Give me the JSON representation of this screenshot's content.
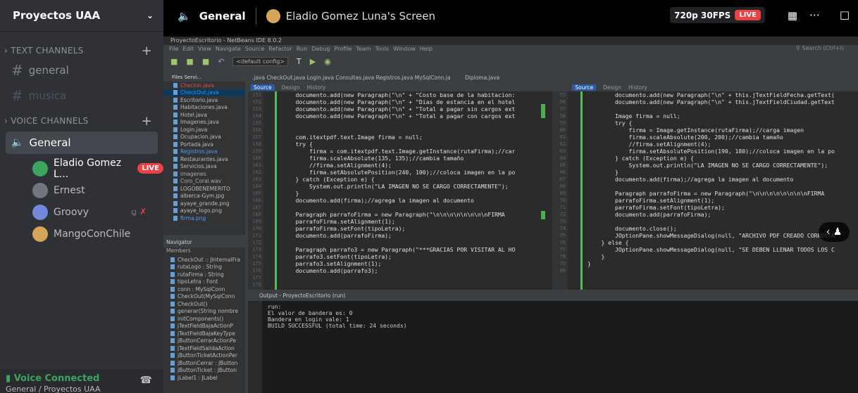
{
  "sidebar": {
    "server_name": "Proyectos UAA",
    "text_category": "TEXT CHANNELS",
    "text_channels": [
      {
        "label": "general"
      },
      {
        "label": "musica"
      }
    ],
    "voice_category": "VOICE CHANNELS",
    "voice_channel": "General",
    "users": [
      {
        "name": "Eladio Gomez L...",
        "badge": "LIVE",
        "color": "#3ba55d"
      },
      {
        "name": "Ernest",
        "color": "#72767d"
      },
      {
        "name": "Groovy",
        "color": "#7289da"
      },
      {
        "name": "MangoConChile",
        "color": "#d4a45a"
      }
    ],
    "voice_status": "Voice Connected",
    "voice_location": "General / Proyectos UAA"
  },
  "topbar": {
    "channel": "General",
    "screen_title": "Eladio Gomez Luna's Screen",
    "quality": "720p 30FPS",
    "live": "LIVE"
  },
  "netbeans": {
    "window_title": "ProyectoEscritorio - NetBeans IDE 8.0.2",
    "menu": [
      "File",
      "Edit",
      "View",
      "Navigate",
      "Source",
      "Refactor",
      "Run",
      "Debug",
      "Profile",
      "Team",
      "Tools",
      "Window",
      "Help"
    ],
    "search_placeholder": "Search (Ctrl+I)",
    "config_label": "<default config>",
    "files_tabs": "Files   Servi...",
    "files": [
      {
        "label": "Checkin.java",
        "style": "red"
      },
      {
        "label": "CheckOut.java",
        "style": "sel"
      },
      {
        "label": "Escritorio.java",
        "style": ""
      },
      {
        "label": "Habitaciones.java",
        "style": ""
      },
      {
        "label": "Hotel.java",
        "style": ""
      },
      {
        "label": "Imagenes.java",
        "style": ""
      },
      {
        "label": "Login.java",
        "style": ""
      },
      {
        "label": "Ocupacion.java",
        "style": ""
      },
      {
        "label": "Portada.java",
        "style": ""
      },
      {
        "label": "Registros.java",
        "style": "blue"
      },
      {
        "label": "Restaurantes.java",
        "style": ""
      },
      {
        "label": "Servicios.java",
        "style": ""
      },
      {
        "label": "imagenes",
        "style": "dim"
      },
      {
        "label": "Coro_Coral.wav",
        "style": "dim"
      },
      {
        "label": "LOGOBENEMERITO",
        "style": ""
      },
      {
        "label": "alberca-Gym.jpg",
        "style": ""
      },
      {
        "label": "ayaye_grande.png",
        "style": ""
      },
      {
        "label": "ayaye_logo.png",
        "style": ""
      },
      {
        "label": "firma.png",
        "style": "blue"
      }
    ],
    "navigator_title": "Navigator",
    "navigator_members": "Members",
    "navigator_items": [
      "CheckOut :: JInternalFra",
      "rutaLogo : String",
      "rutaFirma : String",
      "tipoLetra : Font",
      "conn : MySqlConn",
      "CheckOut(MySqlConn",
      "CheckOut()",
      "generar(String nombre",
      "initComponents()",
      "jTextFieldBajaActionP",
      "jTextFieldBajaKeyType",
      "jButtonCerrarActionPe",
      "jTextFieldSalidaAction",
      "jButtonTicketActionPer",
      "jButtonCerrar : JButton",
      "jButtonTicket : JButton",
      "jLabel1 : JLabel"
    ],
    "editor_tabs": ".java  CheckOut.java  Login.java  Consultas.java  Registros.java  MySqlConn.ja",
    "editor_tabs_right": "Diploma.java",
    "sub_source": "Source",
    "sub_design": "Design",
    "sub_history": "History",
    "left_lines": [
      "151",
      "152",
      "153",
      "154",
      "155",
      "156",
      "157",
      "158",
      "159",
      "160",
      "161",
      "162",
      "163",
      "164",
      "165",
      "166",
      "167",
      "168",
      "169",
      "170",
      "171",
      "172",
      "173",
      "174",
      "175",
      "176",
      "177",
      "178",
      "179"
    ],
    "left_code": [
      "    documento.add(new Paragraph(\"\\n\" + \"Costo base de la habitacion: ",
      "    documento.add(new Paragraph(\"\\n\" + \"Dias de estancia en el hotel",
      "    documento.add(new Paragraph(\"\\n\" + \"Total a pagar sin cargos ext",
      "    documento.add(new Paragraph(\"\\n\" + \"Total a pagar con cargos ext",
      "",
      "",
      "    com.itextpdf.text.Image firma = null;",
      "    try {",
      "        firma = com.itextpdf.text.Image.getInstance(rutaFirma);//car",
      "        firma.scaleAbsolute(135, 135);//cambia tamaño",
      "        //firma.setAlignment(4);",
      "        firma.setAbsolutePosition(240, 100);//coloca imagen en la po",
      "    } catch (Exception e) {",
      "        System.out.println(\"LA IMAGEN NO SE CARGO CORRECTAMENTE\");",
      "    }",
      "    documento.add(firma);//agrega la imagen al documento",
      "",
      "    Paragraph parrafoFirma = new Paragraph(\"\\n\\n\\n\\n\\n\\n\\n\\nFIRMA",
      "    parrafoFirma.setAlignment(1);",
      "    parrafoFirma.setFont(tipoLetra);",
      "    documento.add(parrafoFirma);",
      "",
      "    Paragraph parrafo3 = new Paragraph(\"***GRACIAS POR VISITAR AL HO",
      "    parrafo3.setFont(tipoLetra);",
      "    parrafo3.setAlignment(1);",
      "    documento.add(parrafo3);",
      "",
      "",
      ""
    ],
    "right_lines": [
      "55",
      "56",
      "57",
      "58",
      "59",
      "60",
      "61",
      "62",
      "63",
      "64",
      "65",
      "66",
      "67",
      "68",
      "69",
      "70",
      "71",
      "72",
      "73",
      "74",
      "75",
      "76",
      "77",
      "78",
      "79",
      "80"
    ],
    "right_code": [
      "        documento.add(new Paragraph(\"\\n\" + this.jTextFieldFecha.getText(",
      "        documento.add(new Paragraph(\"\\n\" + this.jTextFieldCiudad.getText",
      "",
      "        Image firma = null;",
      "        try {",
      "            firma = Image.getInstance(rutaFirma);//carga imagen",
      "            firma.scaleAbsolute(200, 200);//cambia tamaño",
      "            //firma.setAlignment(4);",
      "            firma.setAbsolutePosition(190, 180);//coloca imagen en la po",
      "        } catch (Exception e) {",
      "            System.out.println(\"LA IMAGEN NO SE CARGO CORRECTAMENTE\");",
      "        }",
      "        documento.add(firma);//agrega la imagen al documento",
      "",
      "        Paragraph parrafoFirma = new Paragraph(\"\\n\\n\\n\\n\\n\\n\\n\\nFIRMA",
      "        parrafoFirma.setAlignment(1);",
      "        parrafoFirma.setFont(tipoLetra);",
      "        documento.add(parrafoFirma);",
      "",
      "        documento.close();",
      "        JOptionPane.showMessageDialog(null, \"ARCHIVO PDF CREADO CORRECTA",
      "    } else {",
      "        JOptionPane.showMessageDialog(null, \"SE DEBEN LLENAR TODOS LOS C",
      "    }",
      "}",
      ""
    ],
    "output_title": "Output - ProyectoEscritorio (run)",
    "output_text": "run:\nEl valor de bandera es: 0\nBandera en login vale: 1\nBUILD SUCCESSFUL (total time: 24 seconds)"
  }
}
